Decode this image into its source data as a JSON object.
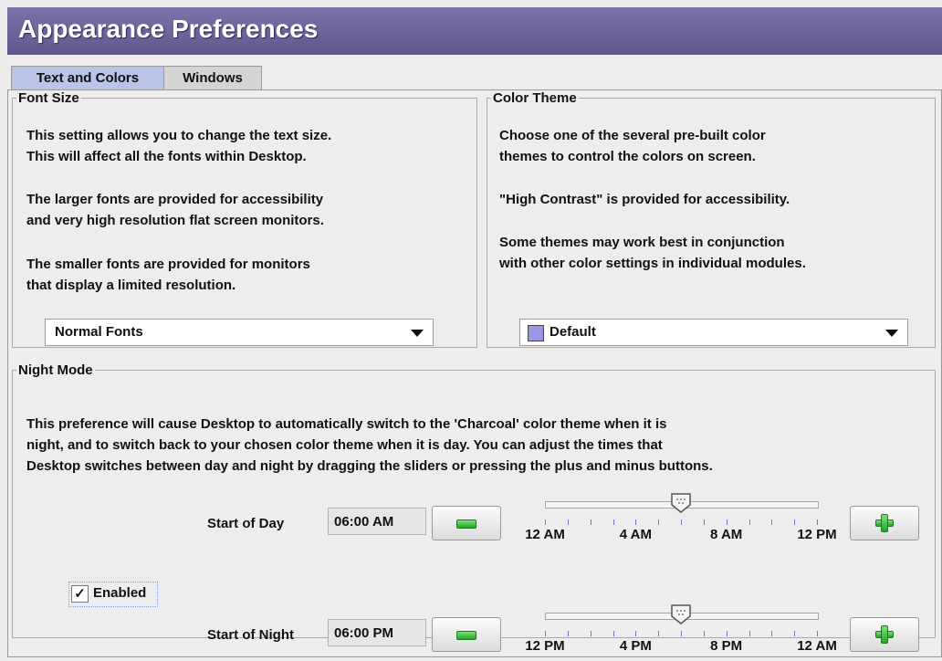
{
  "window": {
    "title": "Appearance Preferences"
  },
  "tabs": [
    {
      "label": "Text and Colors",
      "active": true
    },
    {
      "label": "Windows",
      "active": false
    }
  ],
  "font_size": {
    "legend": "Font Size",
    "lines": [
      "This setting allows you to change the text size.",
      "This will affect all the fonts within Desktop.",
      "The larger fonts are provided for accessibility",
      "and very high resolution flat screen monitors.",
      "The smaller fonts are provided for monitors",
      "that display a limited resolution."
    ],
    "selected": "Normal Fonts"
  },
  "color_theme": {
    "legend": "Color Theme",
    "lines": [
      "Choose one of the several pre-built color",
      "themes to control the colors on screen.",
      "\"High Contrast\" is provided for accessibility.",
      "Some themes may work best in conjunction",
      "with other color settings in individual modules."
    ],
    "selected": "Default",
    "swatch_color": "#9b97e0"
  },
  "night_mode": {
    "legend": "Night Mode",
    "lines": [
      "This preference will cause Desktop to automatically switch to the 'Charcoal' color theme when it is",
      "night, and to switch back to your chosen color theme when it is day.  You can adjust the times that",
      "Desktop switches between day and night by dragging the sliders or pressing the plus and minus buttons."
    ],
    "enabled_label": "Enabled",
    "enabled": true,
    "start_of_day": {
      "label": "Start of Day",
      "value": "06:00 AM",
      "slider_fraction": 0.5,
      "tick_labels": [
        "12 AM",
        "4 AM",
        "8 AM",
        "12 PM"
      ]
    },
    "start_of_night": {
      "label": "Start of Night",
      "value": "06:00 PM",
      "slider_fraction": 0.5,
      "tick_labels": [
        "12 PM",
        "4 PM",
        "8 PM",
        "12 AM"
      ]
    }
  },
  "colors": {
    "title_bar": "#6a639c",
    "active_tab": "#b8c4e8",
    "tick": "#6a7ad0"
  }
}
